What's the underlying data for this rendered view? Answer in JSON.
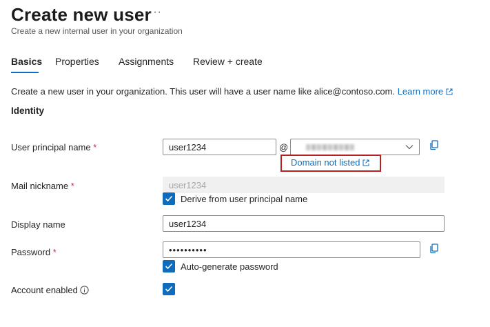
{
  "header": {
    "title": "Create new user",
    "more_label": "···",
    "subtitle": "Create a new internal user in your organization"
  },
  "tabs": [
    {
      "label": "Basics",
      "active": true
    },
    {
      "label": "Properties",
      "active": false
    },
    {
      "label": "Assignments",
      "active": false
    },
    {
      "label": "Review + create",
      "active": false
    }
  ],
  "description": {
    "text": "Create a new user in your organization. This user will have a user name like alice@contoso.com.",
    "link_label": "Learn more"
  },
  "section_title": "Identity",
  "form": {
    "upn": {
      "label": "User principal name",
      "required_mark": "*",
      "value": "user1234",
      "at_symbol": "@",
      "domain_link": "Domain not listed"
    },
    "mail_nickname": {
      "label": "Mail nickname",
      "required_mark": "*",
      "value": "user1234",
      "derive_label": "Derive from user principal name",
      "derive_checked": true
    },
    "display_name": {
      "label": "Display name",
      "value": "user1234"
    },
    "password": {
      "label": "Password",
      "required_mark": "*",
      "value": "••••••••••",
      "autogen_label": "Auto-generate password",
      "autogen_checked": true
    },
    "account_enabled": {
      "label": "Account enabled",
      "checked": true
    }
  },
  "colors": {
    "accent": "#0f6cbd",
    "required": "#c4314b",
    "highlight_box": "#b62020"
  },
  "icons": [
    "more-icon",
    "external-link-icon",
    "chevron-down-icon",
    "copy-icon",
    "checkmark-icon",
    "info-icon"
  ]
}
